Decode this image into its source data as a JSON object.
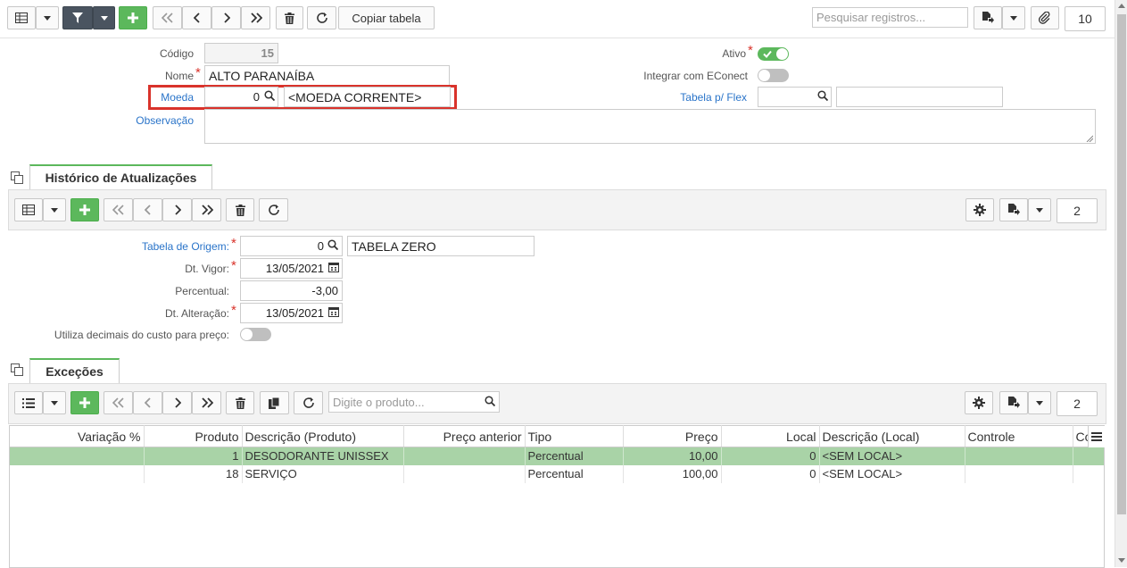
{
  "toolbar": {
    "copy_label": "Copiar tabela",
    "search_placeholder": "Pesquisar registros...",
    "page_size": "10"
  },
  "form": {
    "codigo_label": "Código",
    "codigo_value": "15",
    "nome_label": "Nome",
    "nome_value": "ALTO PARANAÍBA",
    "moeda_label": "Moeda",
    "moeda_code": "0",
    "moeda_desc": "<MOEDA CORRENTE>",
    "observacao_label": "Observação",
    "ativo_label": "Ativo",
    "ativo_on": true,
    "econect_label": "Integrar com EConect",
    "econect_on": false,
    "flex_label": "Tabela p/ Flex",
    "flex_value": "",
    "flex_desc": ""
  },
  "historico": {
    "tab_label": "Histórico de Atualizações",
    "page_size": "2",
    "origem_label": "Tabela de Origem:",
    "origem_code": "0",
    "origem_desc": "TABELA ZERO",
    "vigor_label": "Dt. Vigor:",
    "vigor_value": "13/05/2021",
    "percentual_label": "Percentual:",
    "percentual_value": "-3,00",
    "alteracao_label": "Dt. Alteração:",
    "alteracao_value": "13/05/2021",
    "decimais_label": "Utiliza decimais do custo para preço:",
    "decimais_on": false
  },
  "excecoes": {
    "tab_label": "Exceções",
    "search_placeholder": "Digite o produto...",
    "page_size": "2",
    "columns": [
      "Variação %",
      "Produto",
      "Descrição (Produto)",
      "Preço anterior",
      "Tipo",
      "Preço",
      "Local",
      "Descrição (Local)",
      "Controle",
      "Co"
    ],
    "rows": [
      {
        "variacao": "",
        "produto": "1",
        "descricao": "DESODORANTE UNISSEX",
        "preco_anterior": "",
        "tipo": "Percentual",
        "preco": "10,00",
        "local": "0",
        "desc_local": "<SEM LOCAL>",
        "controle": "",
        "co": ""
      },
      {
        "variacao": "",
        "produto": "18",
        "descricao": "SERVIÇO",
        "preco_anterior": "",
        "tipo": "Percentual",
        "preco": "100,00",
        "local": "0",
        "desc_local": "<SEM LOCAL>",
        "controle": "",
        "co": ""
      }
    ]
  },
  "colors": {
    "accent_green": "#5cb85c",
    "link_blue": "#2a74c9",
    "highlight_red": "#d9332b",
    "selected_row": "#a9d3a7"
  }
}
